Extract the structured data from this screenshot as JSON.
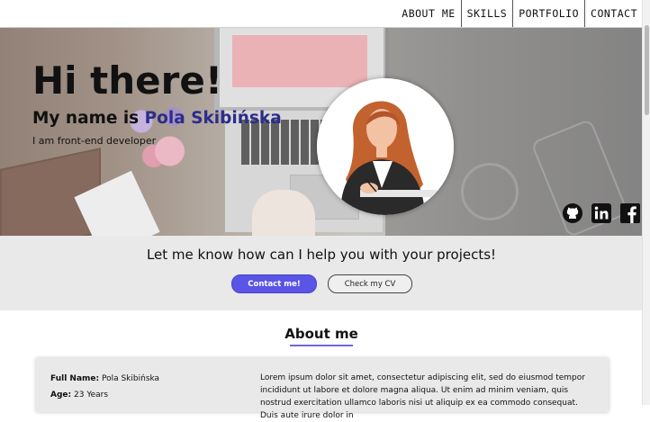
{
  "nav": {
    "items": [
      "ABOUT ME",
      "SKILLS",
      "PORTFOLIO",
      "CONTACT"
    ]
  },
  "hero": {
    "title": "Hi there!",
    "name_prefix": "My name is ",
    "name": "Pola Skibińska",
    "subtitle": "I am front-end developer",
    "social_icons": [
      "github-icon",
      "linkedin-icon",
      "facebook-icon"
    ]
  },
  "cta": {
    "text": "Let me know how can I help you with your projects!",
    "primary_label": "Contact me!",
    "secondary_label": "Check my CV"
  },
  "about": {
    "title": "About me",
    "full_name_label": "Full Name:",
    "full_name_value": "Pola Skibińska",
    "age_label": "Age:",
    "age_value": "23 Years",
    "description": "Lorem ipsum dolor sit amet, consectetur adipiscing elit, sed do eiusmod tempor incididunt ut labore et dolore magna aliqua. Ut enim ad minim veniam, quis nostrud exercitation ullamco laboris nisi ut aliquip ex ea commodo consequat. Duis aute irure dolor in"
  },
  "colors": {
    "accent": "#5a55e6",
    "name_accent": "#2c2c8c",
    "band_bg": "#e9e9e9"
  }
}
